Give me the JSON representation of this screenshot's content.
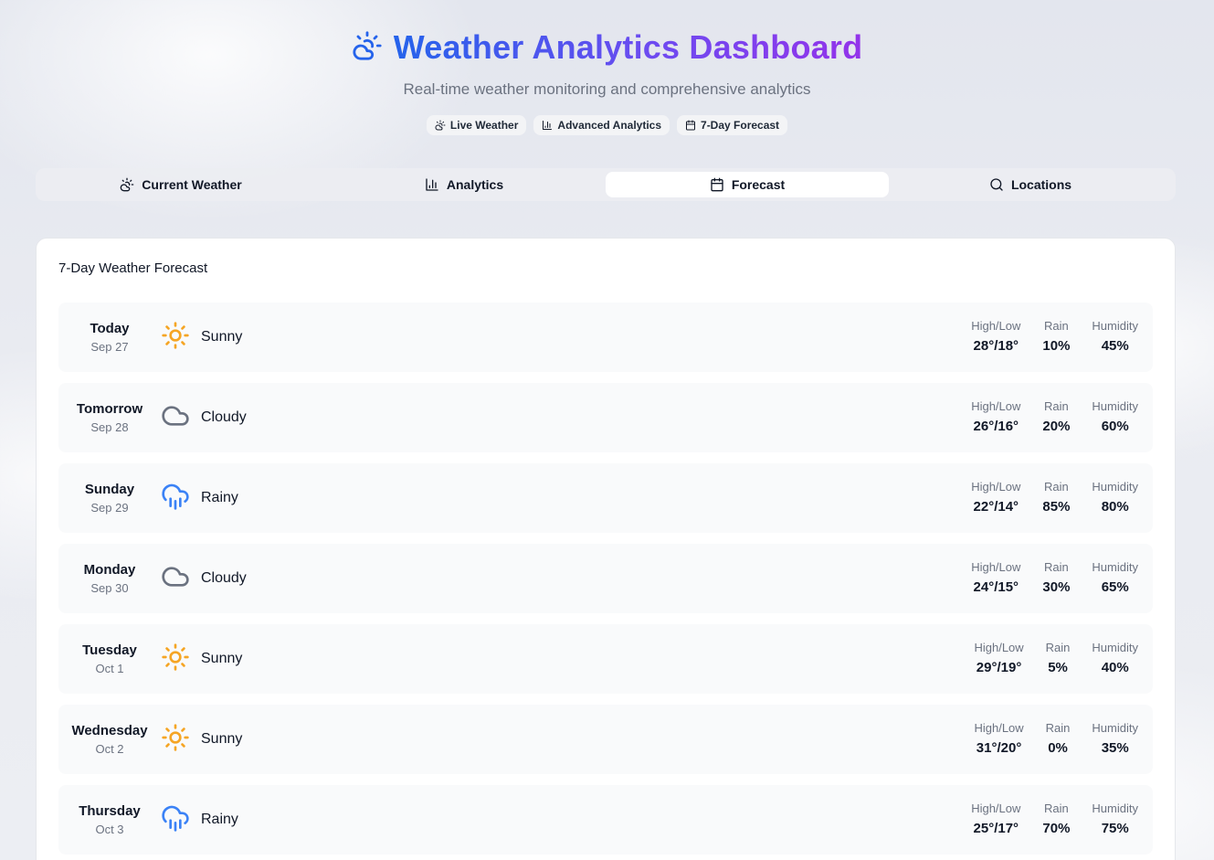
{
  "header": {
    "title": "Weather Analytics Dashboard",
    "subtitle": "Real-time weather monitoring and comprehensive analytics",
    "badges": [
      {
        "label": "Live Weather",
        "icon": "cloud-sun-icon"
      },
      {
        "label": "Advanced Analytics",
        "icon": "bar-chart-icon"
      },
      {
        "label": "7-Day Forecast",
        "icon": "calendar-icon"
      }
    ]
  },
  "tabs": [
    {
      "label": "Current Weather",
      "icon": "cloud-sun-icon",
      "active": false
    },
    {
      "label": "Analytics",
      "icon": "bar-chart-icon",
      "active": false
    },
    {
      "label": "Forecast",
      "icon": "calendar-icon",
      "active": true
    },
    {
      "label": "Locations",
      "icon": "search-icon",
      "active": false
    }
  ],
  "forecast": {
    "title": "7-Day Weather Forecast",
    "stat_labels": {
      "highlow": "High/Low",
      "rain": "Rain",
      "humidity": "Humidity"
    },
    "days": [
      {
        "day": "Today",
        "date": "Sep 27",
        "condition": "Sunny",
        "icon": "sun-icon",
        "highlow": "28°/18°",
        "rain": "10%",
        "humidity": "45%"
      },
      {
        "day": "Tomorrow",
        "date": "Sep 28",
        "condition": "Cloudy",
        "icon": "cloud-icon",
        "highlow": "26°/16°",
        "rain": "20%",
        "humidity": "60%"
      },
      {
        "day": "Sunday",
        "date": "Sep 29",
        "condition": "Rainy",
        "icon": "rain-icon",
        "highlow": "22°/14°",
        "rain": "85%",
        "humidity": "80%"
      },
      {
        "day": "Monday",
        "date": "Sep 30",
        "condition": "Cloudy",
        "icon": "cloud-icon",
        "highlow": "24°/15°",
        "rain": "30%",
        "humidity": "65%"
      },
      {
        "day": "Tuesday",
        "date": "Oct 1",
        "condition": "Sunny",
        "icon": "sun-icon",
        "highlow": "29°/19°",
        "rain": "5%",
        "humidity": "40%"
      },
      {
        "day": "Wednesday",
        "date": "Oct 2",
        "condition": "Sunny",
        "icon": "sun-icon",
        "highlow": "31°/20°",
        "rain": "0%",
        "humidity": "35%"
      },
      {
        "day": "Thursday",
        "date": "Oct 3",
        "condition": "Rainy",
        "icon": "rain-icon",
        "highlow": "25°/17°",
        "rain": "70%",
        "humidity": "75%"
      }
    ]
  },
  "colors": {
    "title_gradient_start": "#2563eb",
    "title_gradient_end": "#9333ea",
    "sun": "#f5a524",
    "cloud": "#6b7280",
    "rain": "#3b82f6"
  }
}
